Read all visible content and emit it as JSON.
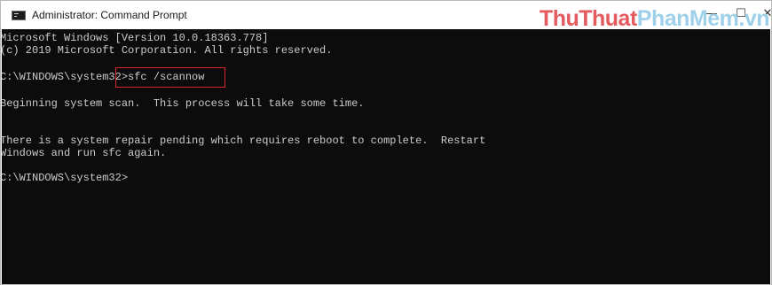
{
  "window": {
    "title": "Administrator: Command Prompt",
    "watermark_part1": "ThuThuat",
    "watermark_part2": "PhanMem",
    "watermark_part3": ".vn",
    "minimize_glyph": "—",
    "maximize_glyph": "☐",
    "close_glyph": "✕"
  },
  "console": {
    "lines": [
      "Microsoft Windows [Version 10.0.18363.778]",
      "(c) 2019 Microsoft Corporation. All rights reserved.",
      "C:\\WINDOWS\\system32>sfc /scannow",
      "Beginning system scan.  This process will take some time.",
      "There is a system repair pending which requires reboot to complete.  Restart",
      "Windows and run sfc again.",
      "C:\\WINDOWS\\system32>"
    ]
  },
  "colors": {
    "console_bg": "#0c0c0c",
    "console_text": "#cccccc",
    "highlight_border": "#d9252a",
    "watermark_red": "#e35b5e",
    "watermark_blue": "#9fd0ea"
  }
}
